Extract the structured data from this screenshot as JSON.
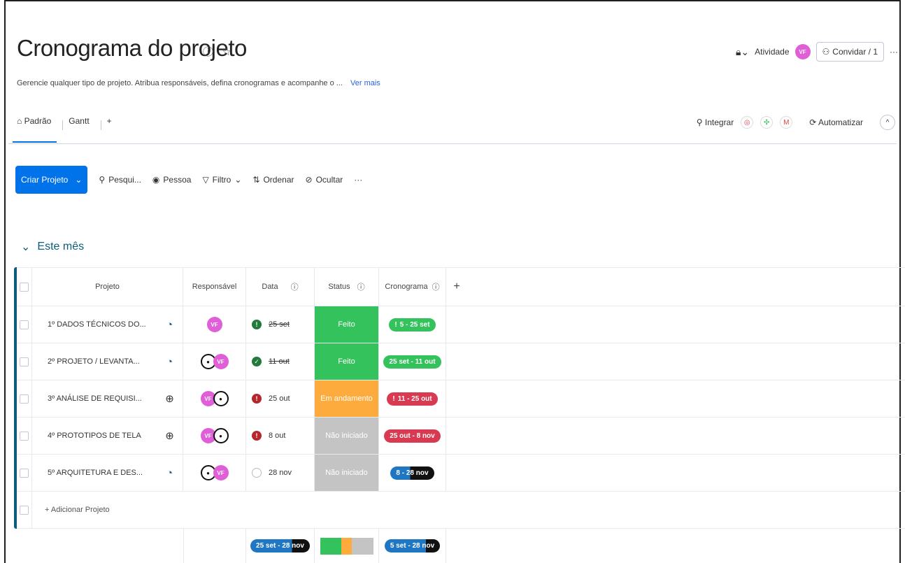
{
  "header": {
    "title": "Cronograma do projeto",
    "subtitle": "Gerencie qualquer tipo de projeto. Atribua responsáveis, defina cronogramas e acompanhe o ...",
    "see_more": "Ver mais",
    "activity": "Atividade",
    "activity_avatar": "VF",
    "invite": "Convidar / 1"
  },
  "tabs": {
    "items": [
      "Padrão",
      "Gantt"
    ],
    "add": "+",
    "integrate": "Integrar",
    "automate": "Automatizar"
  },
  "toolbar": {
    "create": "Criar Projeto",
    "search": "Pesqui...",
    "person": "Pessoa",
    "filter": "Filtro",
    "sort": "Ordenar",
    "hide": "Ocultar",
    "more": "···"
  },
  "group": {
    "title": "Este mês"
  },
  "table": {
    "columns": {
      "project": "Projeto",
      "owner": "Responsável",
      "date": "Data",
      "status": "Status",
      "timeline": "Cronograma"
    },
    "rows": [
      {
        "name": "1º DADOS TÉCNICOS DO...",
        "date": "25 set",
        "status": "Feito",
        "timeline": "5 - 25 set"
      },
      {
        "name": "2º PROJETO / LEVANTA...",
        "date": "11 out",
        "status": "Feito",
        "timeline": "25 set - 11 out"
      },
      {
        "name": "3º ANÁLISE DE REQUISI...",
        "date": "25 out",
        "status": "Em andamento",
        "timeline": "11 - 25 out"
      },
      {
        "name": "4º PROTOTIPOS DE TELA",
        "date": "8 out",
        "status": "Não iniciado",
        "timeline": "25 out - 8 nov"
      },
      {
        "name": "5º ARQUITETURA E DES...",
        "date": "28 nov",
        "status": "Não iniciado",
        "timeline": "8 - 28 nov"
      }
    ],
    "add_row": "+ Adicionar Projeto",
    "summary": {
      "date": "25 set - 28 nov",
      "timeline": "5 set - 28 nov"
    }
  },
  "colors": {
    "done": "#33c25b",
    "working": "#fdab3d",
    "not_started": "#c4c4c4",
    "primary": "#0073ea"
  }
}
